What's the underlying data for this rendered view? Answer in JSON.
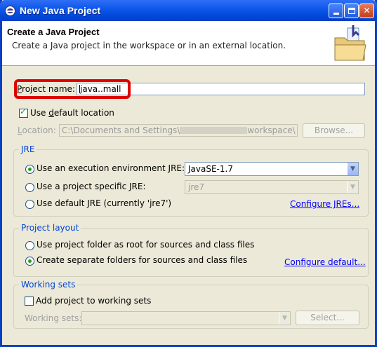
{
  "window": {
    "title": "New Java Project",
    "controls": [
      "minimize-icon",
      "maximize-icon",
      "close-icon"
    ]
  },
  "banner": {
    "title": "Create a Java Project",
    "description": "Create a Java project in the workspace or in an external location.",
    "icon": "java-project-folder-icon"
  },
  "project": {
    "name_label_prefix": "P",
    "name_label_rest": "roject name:",
    "name_value": "java..mall"
  },
  "location": {
    "use_default_label_prefix": "Use ",
    "use_default_label_key": "d",
    "use_default_label_rest": "efault location",
    "use_default_checked": true,
    "label_prefix": "L",
    "label_rest": "ocation:",
    "value_start": "C:\\Documents and Settings\\",
    "value_end": "workspace\\",
    "browse_label": "Browse..."
  },
  "jre": {
    "group_title": "JRE",
    "option_env": "Use an execution environment JRE:",
    "option_env_selected": true,
    "env_value": "JavaSE-1.7",
    "option_specific": "Use a project specific JRE:",
    "specific_value": "jre7",
    "option_default": "Use default JRE (currently 'jre7')",
    "configure_link": "Configure JREs..."
  },
  "layout": {
    "group_title": "Project layout",
    "option_root": "Use project folder as root for sources and class files",
    "option_separate": "Create separate folders for sources and class files",
    "option_separate_selected": true,
    "configure_link": "Configure default..."
  },
  "working_sets": {
    "group_title": "Working sets",
    "add_label": "Add project to working sets",
    "add_checked": false,
    "sets_label": "Working sets:",
    "select_label": "Select..."
  },
  "colors": {
    "title_bar": "#0b56e8",
    "highlight": "#e00000",
    "group_title": "#0046d5",
    "link": "#0000ff"
  }
}
